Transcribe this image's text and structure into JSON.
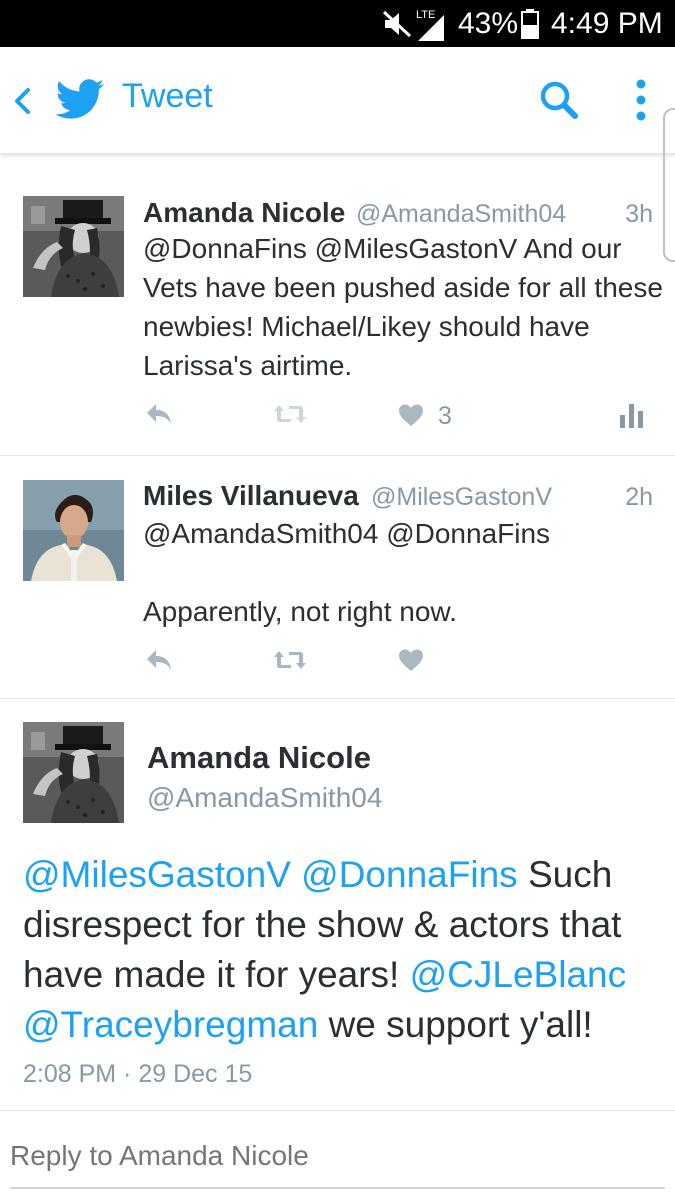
{
  "status_bar": {
    "network": "LTE",
    "battery": "43%",
    "time": "4:49 PM"
  },
  "header": {
    "title": "Tweet",
    "back_icon": "back-chevron-icon",
    "logo_icon": "twitter-bird-icon",
    "search_icon": "search-icon",
    "menu_icon": "overflow-menu-icon"
  },
  "colors": {
    "accent": "#1da1f2",
    "text": "#292f33",
    "muted": "#8899a6"
  },
  "tweets": [
    {
      "name": "Amanda Nicole",
      "handle": "@AmandaSmith04",
      "time": "3h",
      "text": "@DonnaFins @MilesGastonV And our Vets have been pushed aside for all these newbies! Michael/Likey should have Larissa's airtime.",
      "likes": "3"
    },
    {
      "name": "Miles Villanueva",
      "handle": "@MilesGastonV",
      "time": "2h",
      "text_line1": "@AmandaSmith04 @DonnaFins",
      "text_line2": "Apparently, not right now."
    }
  ],
  "focused_tweet": {
    "name": "Amanda Nicole",
    "handle": "@AmandaSmith04",
    "mention1": "@MilesGastonV",
    "mention2": "@DonnaFins",
    "text_part1": "Such disrespect for the show & actors that have made it for years!",
    "mention3": "@CJLeBlanc",
    "mention4": "@Traceybregman",
    "text_part2": "we support y'all!",
    "timestamp": "2:08 PM · 29 Dec 15"
  },
  "reply": {
    "placeholder": "Reply to Amanda Nicole"
  }
}
